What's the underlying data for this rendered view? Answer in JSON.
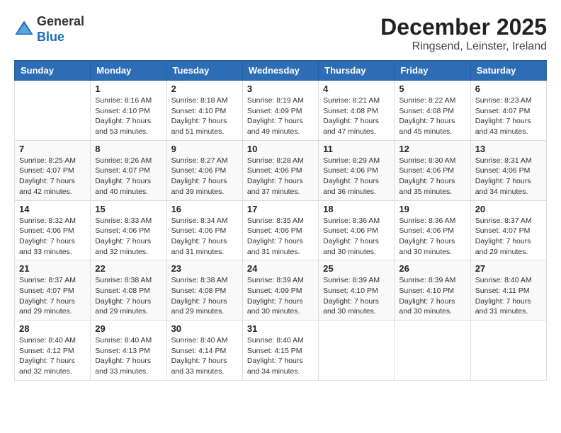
{
  "header": {
    "logo": {
      "line1": "General",
      "line2": "Blue"
    },
    "title": "December 2025",
    "location": "Ringsend, Leinster, Ireland"
  },
  "days_of_week": [
    "Sunday",
    "Monday",
    "Tuesday",
    "Wednesday",
    "Thursday",
    "Friday",
    "Saturday"
  ],
  "weeks": [
    [
      {
        "day": "",
        "info": ""
      },
      {
        "day": "1",
        "info": "Sunrise: 8:16 AM\nSunset: 4:10 PM\nDaylight: 7 hours\nand 53 minutes."
      },
      {
        "day": "2",
        "info": "Sunrise: 8:18 AM\nSunset: 4:10 PM\nDaylight: 7 hours\nand 51 minutes."
      },
      {
        "day": "3",
        "info": "Sunrise: 8:19 AM\nSunset: 4:09 PM\nDaylight: 7 hours\nand 49 minutes."
      },
      {
        "day": "4",
        "info": "Sunrise: 8:21 AM\nSunset: 4:08 PM\nDaylight: 7 hours\nand 47 minutes."
      },
      {
        "day": "5",
        "info": "Sunrise: 8:22 AM\nSunset: 4:08 PM\nDaylight: 7 hours\nand 45 minutes."
      },
      {
        "day": "6",
        "info": "Sunrise: 8:23 AM\nSunset: 4:07 PM\nDaylight: 7 hours\nand 43 minutes."
      }
    ],
    [
      {
        "day": "7",
        "info": "Sunrise: 8:25 AM\nSunset: 4:07 PM\nDaylight: 7 hours\nand 42 minutes."
      },
      {
        "day": "8",
        "info": "Sunrise: 8:26 AM\nSunset: 4:07 PM\nDaylight: 7 hours\nand 40 minutes."
      },
      {
        "day": "9",
        "info": "Sunrise: 8:27 AM\nSunset: 4:06 PM\nDaylight: 7 hours\nand 39 minutes."
      },
      {
        "day": "10",
        "info": "Sunrise: 8:28 AM\nSunset: 4:06 PM\nDaylight: 7 hours\nand 37 minutes."
      },
      {
        "day": "11",
        "info": "Sunrise: 8:29 AM\nSunset: 4:06 PM\nDaylight: 7 hours\nand 36 minutes."
      },
      {
        "day": "12",
        "info": "Sunrise: 8:30 AM\nSunset: 4:06 PM\nDaylight: 7 hours\nand 35 minutes."
      },
      {
        "day": "13",
        "info": "Sunrise: 8:31 AM\nSunset: 4:06 PM\nDaylight: 7 hours\nand 34 minutes."
      }
    ],
    [
      {
        "day": "14",
        "info": "Sunrise: 8:32 AM\nSunset: 4:06 PM\nDaylight: 7 hours\nand 33 minutes."
      },
      {
        "day": "15",
        "info": "Sunrise: 8:33 AM\nSunset: 4:06 PM\nDaylight: 7 hours\nand 32 minutes."
      },
      {
        "day": "16",
        "info": "Sunrise: 8:34 AM\nSunset: 4:06 PM\nDaylight: 7 hours\nand 31 minutes."
      },
      {
        "day": "17",
        "info": "Sunrise: 8:35 AM\nSunset: 4:06 PM\nDaylight: 7 hours\nand 31 minutes."
      },
      {
        "day": "18",
        "info": "Sunrise: 8:36 AM\nSunset: 4:06 PM\nDaylight: 7 hours\nand 30 minutes."
      },
      {
        "day": "19",
        "info": "Sunrise: 8:36 AM\nSunset: 4:06 PM\nDaylight: 7 hours\nand 30 minutes."
      },
      {
        "day": "20",
        "info": "Sunrise: 8:37 AM\nSunset: 4:07 PM\nDaylight: 7 hours\nand 29 minutes."
      }
    ],
    [
      {
        "day": "21",
        "info": "Sunrise: 8:37 AM\nSunset: 4:07 PM\nDaylight: 7 hours\nand 29 minutes."
      },
      {
        "day": "22",
        "info": "Sunrise: 8:38 AM\nSunset: 4:08 PM\nDaylight: 7 hours\nand 29 minutes."
      },
      {
        "day": "23",
        "info": "Sunrise: 8:38 AM\nSunset: 4:08 PM\nDaylight: 7 hours\nand 29 minutes."
      },
      {
        "day": "24",
        "info": "Sunrise: 8:39 AM\nSunset: 4:09 PM\nDaylight: 7 hours\nand 30 minutes."
      },
      {
        "day": "25",
        "info": "Sunrise: 8:39 AM\nSunset: 4:10 PM\nDaylight: 7 hours\nand 30 minutes."
      },
      {
        "day": "26",
        "info": "Sunrise: 8:39 AM\nSunset: 4:10 PM\nDaylight: 7 hours\nand 30 minutes."
      },
      {
        "day": "27",
        "info": "Sunrise: 8:40 AM\nSunset: 4:11 PM\nDaylight: 7 hours\nand 31 minutes."
      }
    ],
    [
      {
        "day": "28",
        "info": "Sunrise: 8:40 AM\nSunset: 4:12 PM\nDaylight: 7 hours\nand 32 minutes."
      },
      {
        "day": "29",
        "info": "Sunrise: 8:40 AM\nSunset: 4:13 PM\nDaylight: 7 hours\nand 33 minutes."
      },
      {
        "day": "30",
        "info": "Sunrise: 8:40 AM\nSunset: 4:14 PM\nDaylight: 7 hours\nand 33 minutes."
      },
      {
        "day": "31",
        "info": "Sunrise: 8:40 AM\nSunset: 4:15 PM\nDaylight: 7 hours\nand 34 minutes."
      },
      {
        "day": "",
        "info": ""
      },
      {
        "day": "",
        "info": ""
      },
      {
        "day": "",
        "info": ""
      }
    ]
  ]
}
